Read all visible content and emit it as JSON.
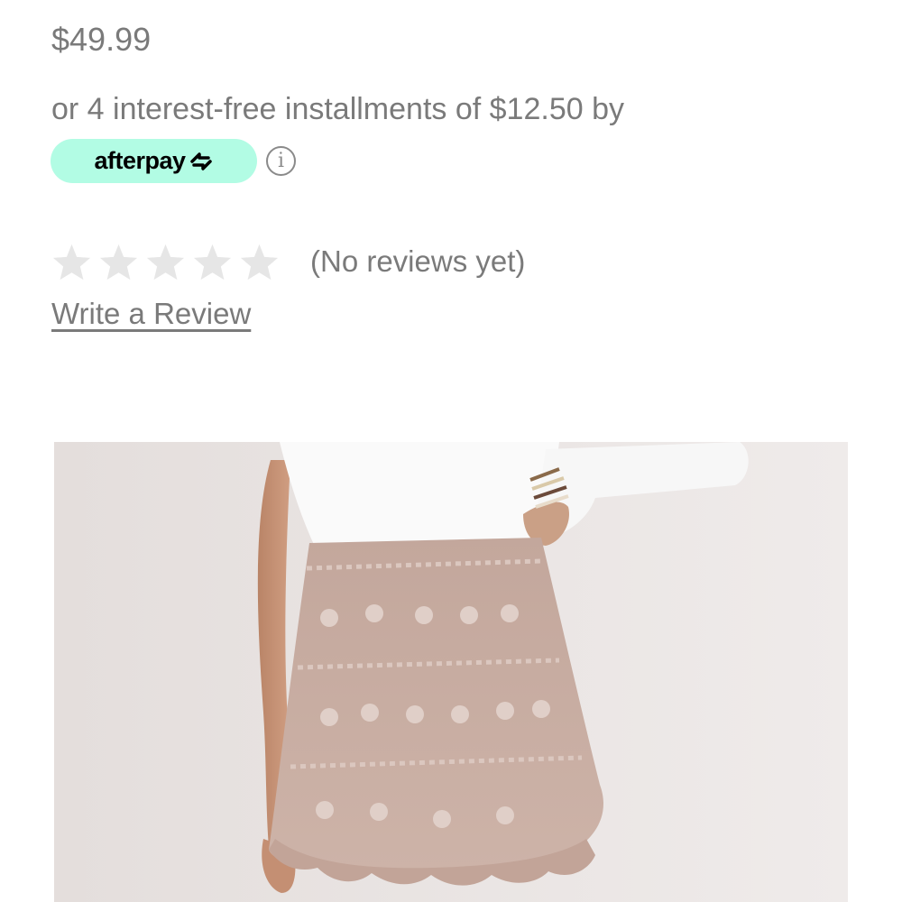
{
  "product": {
    "price": "$49.99",
    "installments_text": "or 4 interest-free installments of $12.50 by",
    "afterpay": {
      "brand_label": "afterpay",
      "badge_color": "#b2fce4",
      "info_icon": "info-icon",
      "info_glyph": "i"
    },
    "rating": {
      "stars_filled": 0,
      "stars_total": 5,
      "star_icon": "star-icon",
      "empty_star_color": "#e6e6e6",
      "no_reviews_text": "(No reviews yet)"
    },
    "write_review_label": "Write a Review",
    "image": {
      "subject": "product-photo",
      "background_color": "#e9e4e2",
      "skirt_color": "#c8aea4",
      "top_color": "#fafafa"
    }
  }
}
